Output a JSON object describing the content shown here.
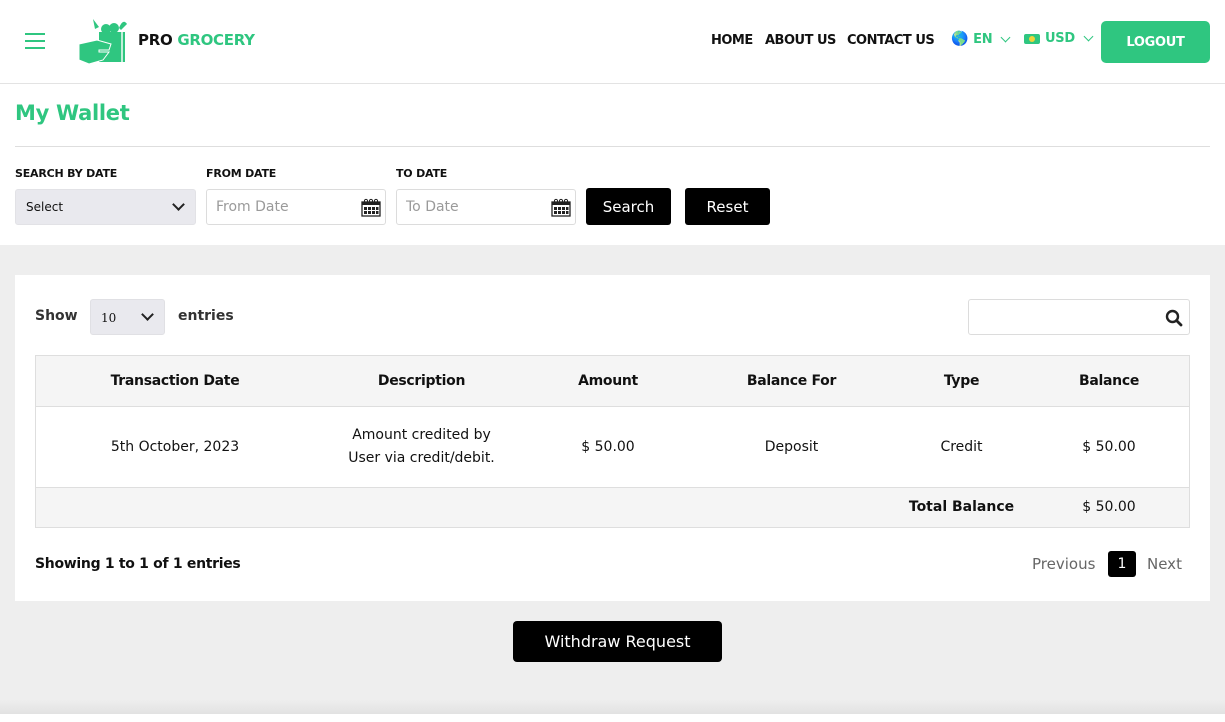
{
  "header": {
    "brand_pro": "PRO",
    "brand_grocery": "GROCERY",
    "nav": [
      {
        "label": "HOME"
      },
      {
        "label": "ABOUT US"
      },
      {
        "label": "CONTACT US"
      }
    ],
    "language": {
      "icon": "globe-icon",
      "value": "EN"
    },
    "currency": {
      "icon": "money-icon",
      "value": "USD"
    },
    "logout_label": "LOGOUT"
  },
  "colors": {
    "accent": "#2fc680",
    "button_dark": "#000000",
    "band": "#eeeeee"
  },
  "page": {
    "title": "My Wallet"
  },
  "filters": {
    "search_by_date_label": "SEARCH BY DATE",
    "search_by_date_value": "Select",
    "from_date_label": "FROM DATE",
    "from_date_placeholder": "From Date",
    "to_date_label": "TO DATE",
    "to_date_placeholder": "To Date",
    "search_label": "Search",
    "reset_label": "Reset"
  },
  "table_controls": {
    "show_label": "Show",
    "entries_value": "10",
    "entries_label": "entries",
    "search_value": ""
  },
  "table": {
    "columns": [
      "Transaction Date",
      "Description",
      "Amount",
      "Balance For",
      "Type",
      "Balance"
    ],
    "rows": [
      {
        "date": "5th October, 2023",
        "description_line1": "Amount credited by",
        "description_line2": "User via credit/debit.",
        "amount": "$ 50.00",
        "balance_for": "Deposit",
        "type": "Credit",
        "balance": "$ 50.00"
      }
    ],
    "total_label": "Total Balance",
    "total_value": "$ 50.00"
  },
  "pagination": {
    "info": "Showing 1 to 1 of 1 entries",
    "previous": "Previous",
    "current_page": "1",
    "next": "Next"
  },
  "withdraw_label": "Withdraw Request"
}
